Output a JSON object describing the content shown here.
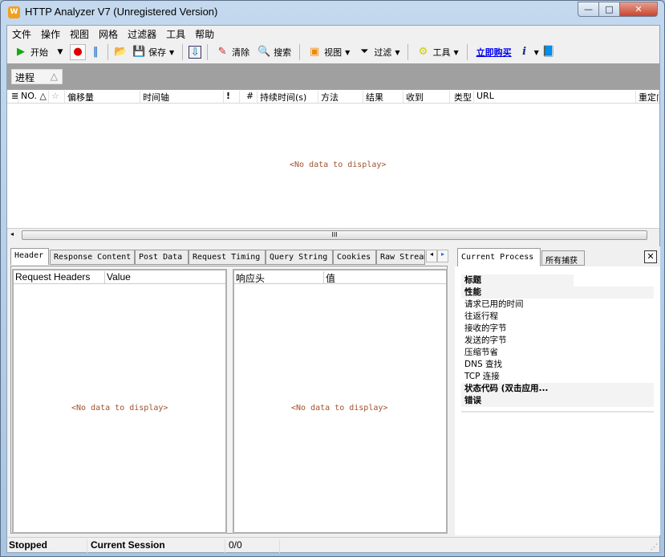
{
  "window": {
    "title": "HTTP Analyzer V7  (Unregistered Version)",
    "minimize": "—",
    "maximize": "□",
    "close": "✕"
  },
  "menu": [
    "文件",
    "操作",
    "视图",
    "网格",
    "过滤器",
    "工具",
    "帮助"
  ],
  "toolbar": {
    "start": "开始",
    "save": "保存",
    "clear": "清除",
    "search": "搜索",
    "view": "视图",
    "filter": "过滤",
    "tools": "工具",
    "buy_now": "立即购买"
  },
  "group_panel": {
    "chip": "进程",
    "sort": "△"
  },
  "grid": {
    "columns": [
      "NO. △",
      "偏移量",
      "时间轴",
      "!",
      "#",
      "持续时间(s)",
      "方法",
      "结果",
      "收到",
      "类型",
      "URL",
      "重定向"
    ],
    "empty": "<No data to display>",
    "scroll_grip": "III"
  },
  "detail_tabs": [
    "Header",
    "Response Content",
    "Post Data",
    "Request Timing",
    "Query String",
    "Cookies",
    "Raw Stream"
  ],
  "request_headers": {
    "columns": [
      "Request Headers",
      "Value"
    ],
    "empty": "<No data to display>"
  },
  "response_headers": {
    "columns": [
      "响应头",
      "值"
    ],
    "empty": "<No data to display>"
  },
  "side_tabs": [
    "Current Process",
    "所有捕获"
  ],
  "properties": [
    {
      "label": "标题",
      "bold": true
    },
    {
      "label": "性能",
      "bold": true
    },
    {
      "label": "请求已用的时间"
    },
    {
      "label": "往返行程"
    },
    {
      "label": "接收的字节"
    },
    {
      "label": "发送的字节"
    },
    {
      "label": "压缩节省"
    },
    {
      "label": "DNS 查找"
    },
    {
      "label": "TCP 连接"
    },
    {
      "label": "状态代码  (双击应用...",
      "bold": true
    },
    {
      "label": "错误",
      "bold": true
    }
  ],
  "status": {
    "state": "Stopped",
    "session": "Current Session",
    "count": "0/0"
  },
  "colors": {
    "link": "#0000ee",
    "nodata": "#a0522d",
    "group_bg": "#a0a0a0"
  }
}
